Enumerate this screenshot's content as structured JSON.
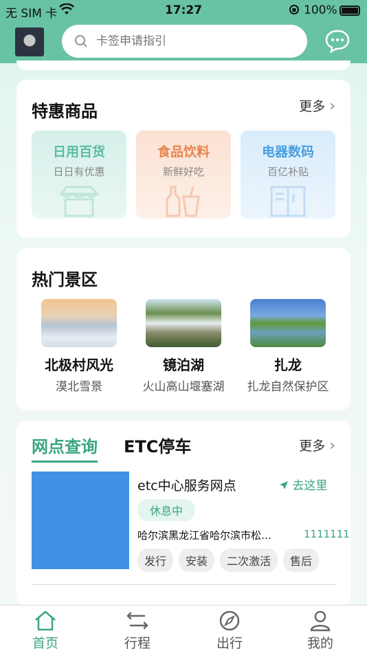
{
  "status": {
    "carrier": "无 SIM 卡",
    "time": "17:27",
    "battery": "100%"
  },
  "search": {
    "placeholder": "卡签申请指引"
  },
  "deals": {
    "title": "特惠商品",
    "more": "更多",
    "items": [
      {
        "title": "日用百货",
        "sub": "日日有优惠",
        "color": "#5bbda0"
      },
      {
        "title": "食品饮料",
        "sub": "新鲜好吃",
        "color": "#e8844e"
      },
      {
        "title": "电器数码",
        "sub": "百亿补贴",
        "color": "#4a9fe0"
      }
    ]
  },
  "scenic": {
    "title": "热门景区",
    "items": [
      {
        "name": "北极村风光",
        "desc": "漠北雪景"
      },
      {
        "name": "镜泊湖",
        "desc": "火山高山堰塞湖"
      },
      {
        "name": "扎龙",
        "desc": "扎龙自然保护区"
      }
    ]
  },
  "outlets": {
    "tabs": [
      "网点查询",
      "ETC停车"
    ],
    "more": "更多",
    "item": {
      "name": "etc中心服务网点",
      "nav": "去这里",
      "status": "休息中",
      "address": "哈尔滨黑龙江省哈尔滨市松…",
      "phone": "1111111",
      "tags": [
        "发行",
        "安装",
        "二次激活",
        "售后"
      ]
    }
  },
  "tabbar": [
    "首页",
    "行程",
    "出行",
    "我的"
  ],
  "colors": {
    "accent": "#3aa57f",
    "header": "#68c2a4"
  }
}
